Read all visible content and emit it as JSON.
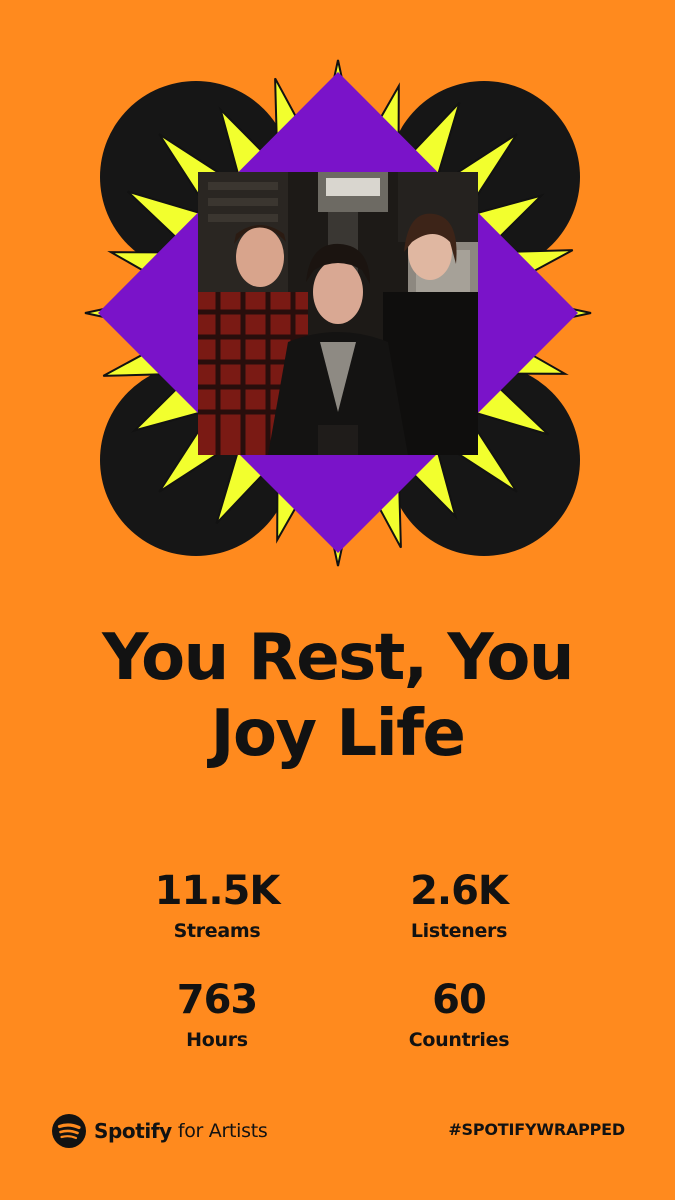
{
  "artist": {
    "name_line1": "You Rest, You",
    "name_line2": "Joy Life",
    "photo": "band-photo"
  },
  "stats": [
    {
      "value": "11.5K",
      "label": "Streams"
    },
    {
      "value": "2.6K",
      "label": "Listeners"
    },
    {
      "value": "763",
      "label": "Hours"
    },
    {
      "value": "60",
      "label": "Countries"
    }
  ],
  "footer": {
    "brand": "Spotify",
    "brand_suffix": "for Artists",
    "logo_icon": "spotify-logo-icon",
    "hashtag": "#SPOTIFYWRAPPED"
  },
  "colors": {
    "background": "#ff8a1e",
    "burst_yellow": "#f2ff2e",
    "diamond_purple": "#7a13c9",
    "circle_black": "#161616",
    "text": "#121212"
  }
}
